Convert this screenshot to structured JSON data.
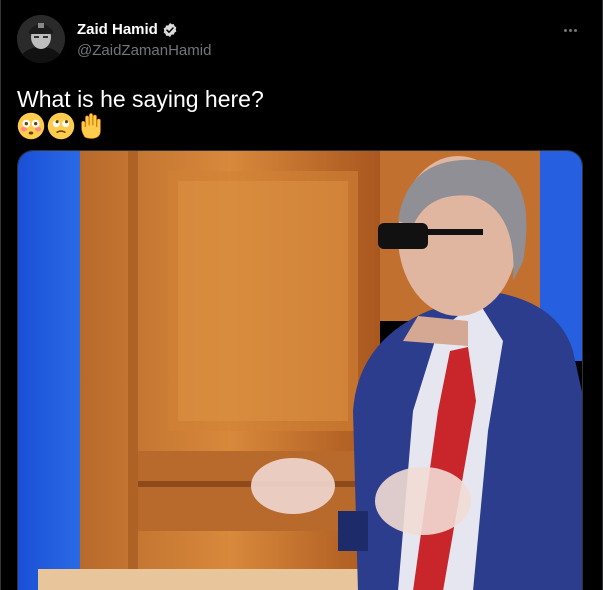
{
  "author": {
    "display_name": "Zaid Hamid",
    "handle": "@ZaidZamanHamid",
    "verified": true
  },
  "tweet": {
    "text": "What is he saying here?",
    "emojis": [
      "flushed-face",
      "face-with-rolling-eyes",
      "raised-hand"
    ]
  },
  "media": {
    "type": "video-frame"
  },
  "colors": {
    "background": "#000000",
    "text": "#ffffff",
    "secondary_text": "#71767b",
    "verified_badge": "#d9d9d9",
    "border": "#2f3336"
  }
}
